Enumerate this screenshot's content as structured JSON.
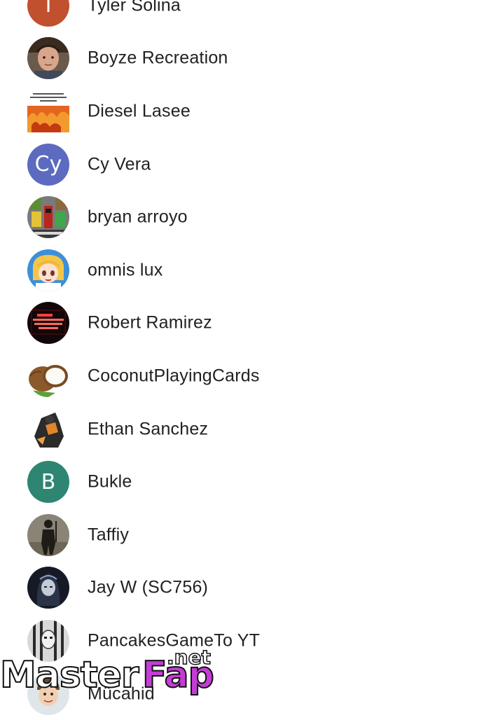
{
  "contacts": [
    {
      "name": "Tyler Solina",
      "avatar": {
        "type": "letter",
        "letter": "T",
        "color": "#c1502e"
      }
    },
    {
      "name": "Boyze Recreation",
      "avatar": {
        "type": "photo",
        "icon": "person-photo-icon"
      }
    },
    {
      "name": "Diesel Lasee",
      "avatar": {
        "type": "photo",
        "icon": "meme-image-icon"
      }
    },
    {
      "name": "Cy Vera",
      "avatar": {
        "type": "letter",
        "letter": "Cy",
        "color": "#5c6bc0"
      }
    },
    {
      "name": "bryan arroyo",
      "avatar": {
        "type": "photo",
        "icon": "minecraft-image-icon"
      }
    },
    {
      "name": "omnis lux",
      "avatar": {
        "type": "photo",
        "icon": "anime-character-icon"
      }
    },
    {
      "name": "Robert Ramirez",
      "avatar": {
        "type": "photo",
        "icon": "neon-sign-icon",
        "text": "Fuck social media. I'm dope in real life."
      }
    },
    {
      "name": "CoconutPlayingCards",
      "avatar": {
        "type": "photo",
        "icon": "coconut-icon"
      }
    },
    {
      "name": "Ethan Sanchez",
      "avatar": {
        "type": "photo",
        "icon": "character-illustration-icon"
      }
    },
    {
      "name": "Bukle",
      "avatar": {
        "type": "letter",
        "letter": "B",
        "color": "#2e8672"
      }
    },
    {
      "name": "Taffiy",
      "avatar": {
        "type": "photo",
        "icon": "silhouette-figure-icon"
      }
    },
    {
      "name": "Jay W (SC756)",
      "avatar": {
        "type": "photo",
        "icon": "hooded-figure-icon"
      }
    },
    {
      "name": "PancakesGameTo YT",
      "avatar": {
        "type": "photo",
        "icon": "masked-face-icon"
      }
    },
    {
      "name": "Mücahid",
      "avatar": {
        "type": "photo",
        "icon": "cartoon-face-icon"
      }
    }
  ],
  "watermark": {
    "master": "Master",
    "fap": "Fap",
    "net": ".net"
  }
}
